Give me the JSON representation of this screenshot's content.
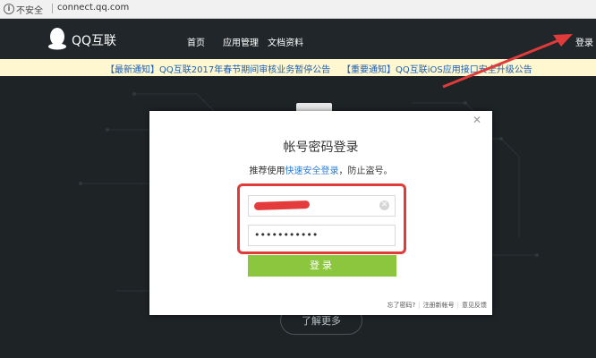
{
  "browser": {
    "security_label": "不安全",
    "url": "connect.qq.com"
  },
  "nav": {
    "logo_text": "QQ互联",
    "items": [
      {
        "label": "首页"
      },
      {
        "label": "应用管理"
      },
      {
        "label": "文档资料"
      }
    ],
    "login_label": "登录"
  },
  "notice": {
    "items": [
      {
        "label": "【最新通知】QQ互联2017年春节期间审核业务暂停公告"
      },
      {
        "label": "【重要通知】QQ互联iOS应用接口安全升级公告"
      }
    ]
  },
  "main": {
    "learn_more_label": "了解更多"
  },
  "modal": {
    "title": "帐号密码登录",
    "subtitle_prefix": "推荐使用",
    "subtitle_link": "快速安全登录",
    "subtitle_suffix": "，防止盗号。",
    "password_value": "•••••••••••",
    "submit_label": "登录",
    "footer": {
      "forgot": "忘了密码?",
      "register": "注册新帐号",
      "feedback": "意见反馈"
    }
  },
  "colors": {
    "accent_green": "#8cc63f",
    "annotation_red": "#e03b3b",
    "link_blue": "#2a7ed3",
    "notice_bg": "#fff7cf"
  }
}
